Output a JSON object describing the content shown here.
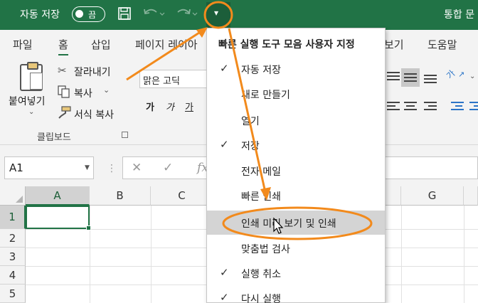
{
  "titlebar": {
    "autosave_label": "자동 저장",
    "toggle_state": "끔",
    "doc_title": "통합 문",
    "icons": [
      "save-icon",
      "undo-icon",
      "redo-icon",
      "customize-qat-icon"
    ],
    "qat_button_glyph": "▾"
  },
  "tabs": [
    {
      "label": "파일"
    },
    {
      "label": "홈"
    },
    {
      "label": "삽입"
    },
    {
      "label": "페이지 레이아"
    },
    {
      "label": "보기"
    },
    {
      "label": "도움말"
    }
  ],
  "ribbon": {
    "paste_label": "붙여넣기",
    "cut_label": "잘라내기",
    "copy_label": "복사",
    "format_painter_label": "서식 복사",
    "clipboard_group": "클립보드",
    "font_name": "맑은 고딕",
    "bold_glyph": "가",
    "italic_glyph": "가",
    "underline_glyph": "가",
    "orientation_glyph": "가"
  },
  "formula_bar": {
    "name_box": "A1",
    "cancel_glyph": "✕",
    "enter_glyph": "✓",
    "fx_glyph": "fx",
    "dots": "⋮"
  },
  "grid": {
    "columns": [
      "A",
      "B",
      "C",
      "G"
    ],
    "rows": [
      "1",
      "2",
      "3",
      "4",
      "5"
    ]
  },
  "menu": {
    "title": "빠른 실행 도구 모음 사용자 지정",
    "items": [
      {
        "label": "자동 저장",
        "checked": true
      },
      {
        "label": "새로 만들기",
        "checked": false
      },
      {
        "label": "열기",
        "checked": false
      },
      {
        "label": "저장",
        "checked": true
      },
      {
        "label": "전자 메일",
        "checked": false
      },
      {
        "label": "빠른 인쇄",
        "checked": false
      },
      {
        "label": "인쇄 미리 보기 및 인쇄",
        "checked": false,
        "highlighted": true
      },
      {
        "label": "맞춤법 검사",
        "checked": false
      },
      {
        "label": "실행 취소",
        "checked": true
      },
      {
        "label": "다시 실행",
        "checked": true
      }
    ],
    "check_glyph": "✓"
  },
  "colors": {
    "titlebar": "#217346",
    "annotation": "#f28a1c",
    "menu_hover": "#d4d4d4"
  }
}
